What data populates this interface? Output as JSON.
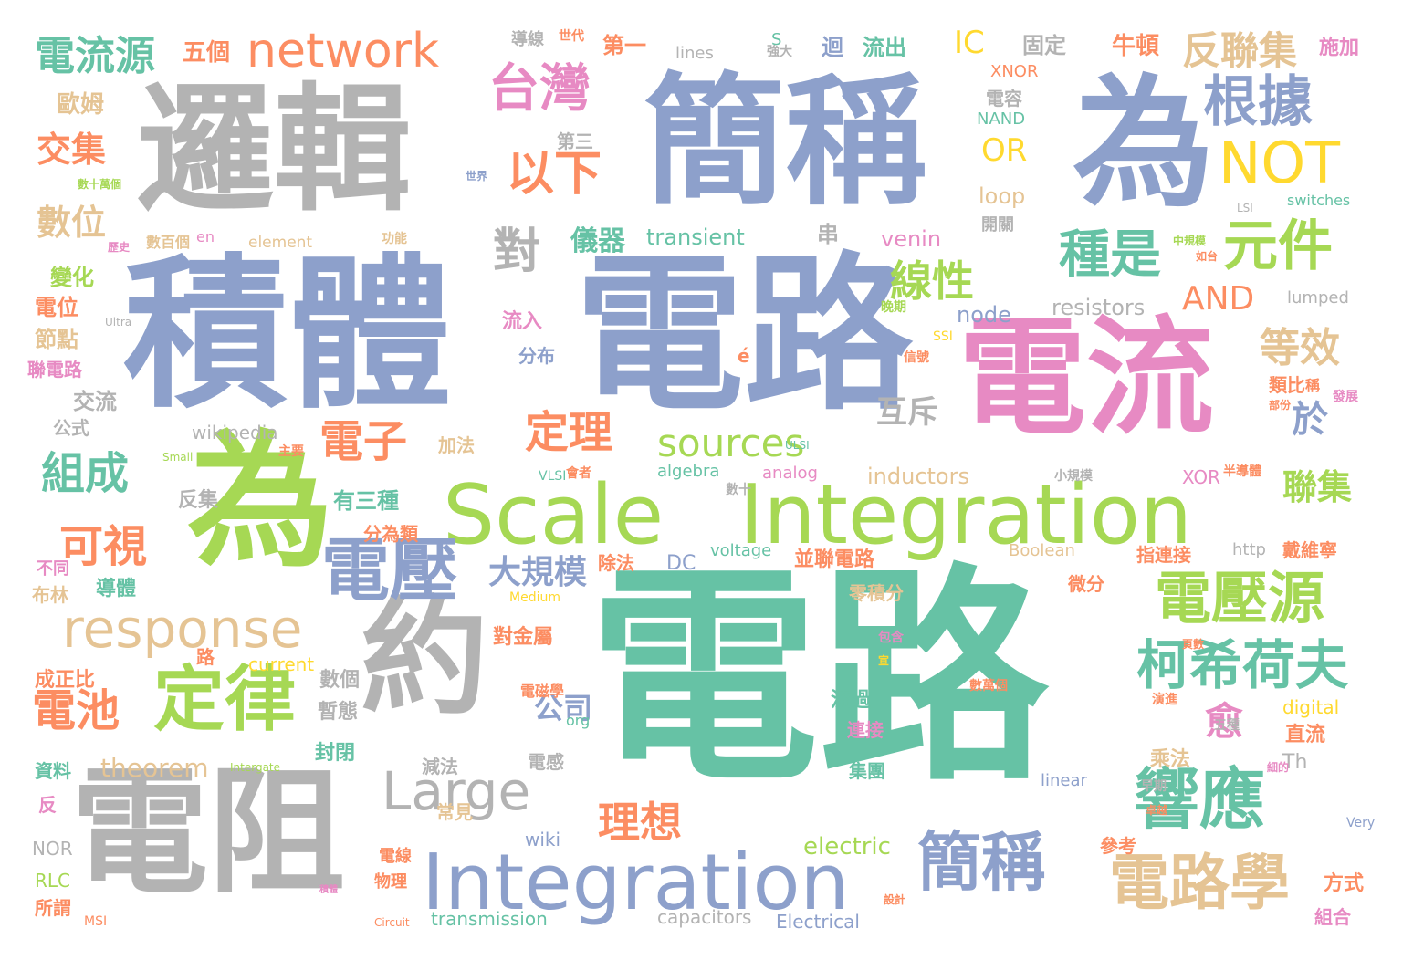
{
  "palette": {
    "teal": "#66c2a5",
    "orange": "#fc8d62",
    "blue": "#8da0cb",
    "pink": "#e78ac3",
    "green": "#a6d854",
    "yellow": "#ffd92f",
    "tan": "#e5c494",
    "gray": "#b3b3b3"
  },
  "words": [
    "電路",
    "電路",
    "積體",
    "邏輯",
    "簡稱",
    "為",
    "為",
    "電流",
    "電阻",
    "約",
    "Scale",
    "Integration",
    "Integration",
    "電壓",
    "定律",
    "響應",
    "簡稱",
    "電路學",
    "柯希荷夫",
    "電壓源",
    "response",
    "Large",
    "台灣",
    "根據",
    "NOT",
    "元件",
    "種是",
    "network",
    "電流源",
    "反聯集",
    "以下",
    "對",
    "線性",
    "等效",
    "sources",
    "定理",
    "電子",
    "組成",
    "可視",
    "電池",
    "數位",
    "交集",
    "AND",
    "OR",
    "IC",
    "聯集",
    "愈",
    "理想",
    "大規模",
    "互斥",
    "於",
    "公司",
    "對金屬",
    "theorem",
    "inductors",
    "electric",
    "transient",
    "venin",
    "node",
    "resistors",
    "loop",
    "XNOR",
    "NAND",
    "電容",
    "第三",
    "第一",
    "五個",
    "歐姆",
    "固定",
    "牛頓",
    "施加",
    "流出",
    "迴",
    "lines",
    "導線",
    "世代",
    "強大",
    "S",
    "element",
    "en",
    "功能",
    "歷史",
    "數百個",
    "數十萬個",
    "世界",
    "儀器",
    "串",
    "開關",
    "switches",
    "LSI",
    "變化",
    "電位",
    "節點",
    "聯電路",
    "Ultra",
    "流入",
    "分布",
    "é",
    "信號",
    "SSI",
    "晚期",
    "中規模",
    "如台",
    "lumped",
    "類比",
    "稱",
    "發展",
    "部份",
    "ULSI",
    "交流",
    "公式",
    "wikipedia",
    "主要",
    "加法",
    "Small",
    "XOR",
    "半導體",
    "小規模",
    "VLSI",
    "algebra",
    "analog",
    "會者",
    "數十",
    "反集",
    "有三種",
    "分為類",
    "除法",
    "DC",
    "voltage",
    "並聯電路",
    "Boolean",
    "http",
    "指連接",
    "戴維寧",
    "零積分",
    "微分",
    "不同",
    "導體",
    "布林",
    "Medium",
    "路",
    "current",
    "成正比",
    "數個",
    "暫態",
    "流過",
    "電磁學",
    "org",
    "數萬個",
    "digital",
    "連接",
    "演進",
    "五種",
    "直流",
    "電感",
    "減法",
    "封閉",
    "集團",
    "Th",
    "乘法",
    "Intergate",
    "資料",
    "linear",
    "早期",
    "細的",
    "反",
    "常見",
    "wiki",
    "NOR",
    "電線",
    "參考",
    "卓越",
    "Very",
    "RLC",
    "物理",
    "方式",
    "所謂",
    "MSI",
    "Circuit",
    "transmission",
    "capacitors",
    "Electrical",
    "積體",
    "設計",
    "組合",
    "包含",
    "頁數",
    "宣"
  ]
}
